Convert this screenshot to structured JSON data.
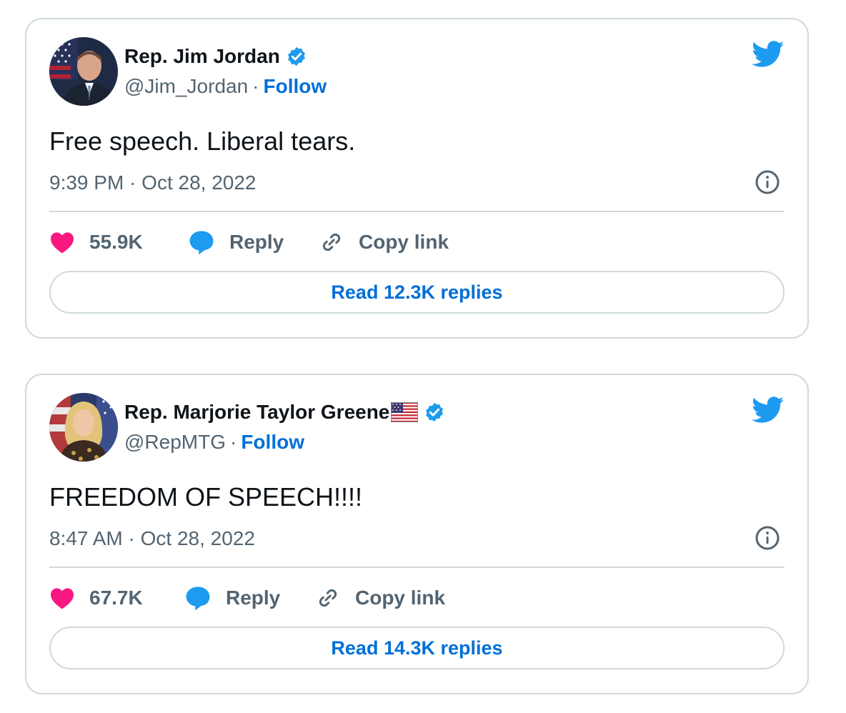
{
  "tweets": [
    {
      "name": "Rep. Jim Jordan",
      "handle": "@Jim_Jordan",
      "separator": "·",
      "follow": "Follow",
      "text": "Free speech. Liberal tears.",
      "time": "9:39 PM · Oct 28, 2022",
      "likes": "55.9K",
      "reply": "Reply",
      "copy_link": "Copy link",
      "read_replies": "Read 12.3K replies"
    },
    {
      "name": "Rep. Marjorie Taylor Greene",
      "handle": "@RepMTG",
      "separator": "·",
      "follow": "Follow",
      "text": "FREEDOM OF SPEECH!!!!",
      "time": "8:47 AM · Oct 28, 2022",
      "likes": "67.7K",
      "reply": "Reply",
      "copy_link": "Copy link",
      "read_replies": "Read 14.3K replies"
    }
  ],
  "icons": {
    "verified": "verified-badge-icon",
    "bird": "twitter-bird-icon",
    "info": "info-icon",
    "heart": "heart-icon",
    "reply": "speech-bubble-icon",
    "link": "link-icon",
    "flag": "us-flag-emoji"
  },
  "colors": {
    "link_blue": "#006fd6",
    "twitter_blue": "#1d9bf0",
    "heart_pink": "#f91880",
    "muted_text": "#536471",
    "border": "#cfd9de"
  }
}
